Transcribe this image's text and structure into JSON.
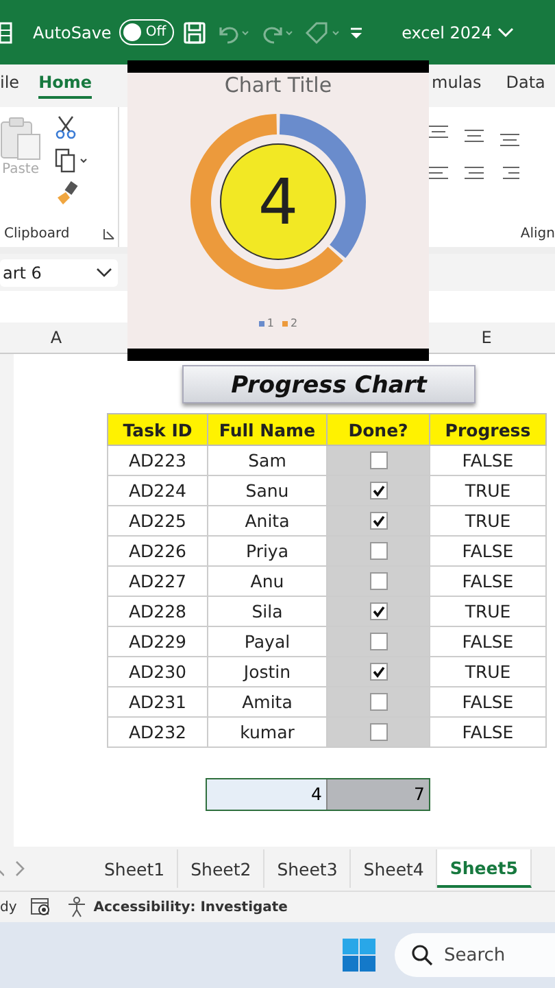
{
  "title_bar": {
    "autosave_label": "AutoSave",
    "autosave_toggle": {
      "label": "Off",
      "on": false
    },
    "workbook": "excel 2024"
  },
  "ribbon_tabs": [
    {
      "label": "ile",
      "selected": false
    },
    {
      "label": "Home",
      "selected": true
    },
    {
      "label": "mulas",
      "selected": false
    },
    {
      "label": "Data",
      "selected": false
    }
  ],
  "clipboard": {
    "paste_label": "Paste",
    "group_label": "Clipboard"
  },
  "alignment_group_label": "Align",
  "name_box": "art 6",
  "column_headers": [
    "A",
    "E"
  ],
  "chart": {
    "center_value": "4",
    "chart_data": {
      "type": "donut",
      "title": "Chart Title",
      "categories": [
        "1",
        "2"
      ],
      "values": [
        36.4,
        63.6
      ]
    },
    "legend": [
      {
        "color": "#6a8ccc"
      },
      {
        "color": "#ec9a3c"
      }
    ]
  },
  "progress_title": "Progress Chart",
  "table": {
    "columns": [
      "Task ID",
      "Full Name",
      "Done?",
      "Progress"
    ],
    "rows": [
      {
        "task_id": "AD223",
        "name": "Sam",
        "done": false,
        "progress": "FALSE"
      },
      {
        "task_id": "AD224",
        "name": "Sanu",
        "done": true,
        "progress": "TRUE"
      },
      {
        "task_id": "AD225",
        "name": "Anita",
        "done": true,
        "progress": "TRUE"
      },
      {
        "task_id": "AD226",
        "name": "Priya",
        "done": false,
        "progress": "FALSE"
      },
      {
        "task_id": "AD227",
        "name": "Anu",
        "done": false,
        "progress": "FALSE"
      },
      {
        "task_id": "AD228",
        "name": "Sila",
        "done": true,
        "progress": "TRUE"
      },
      {
        "task_id": "AD229",
        "name": "Payal",
        "done": false,
        "progress": "FALSE"
      },
      {
        "task_id": "AD230",
        "name": "Jostin",
        "done": true,
        "progress": "TRUE"
      },
      {
        "task_id": "AD231",
        "name": "Amita",
        "done": false,
        "progress": "FALSE"
      },
      {
        "task_id": "AD232",
        "name": "kumar",
        "done": false,
        "progress": "FALSE"
      }
    ]
  },
  "summary_cells": [
    "4",
    "7"
  ],
  "sheet_tabs": [
    {
      "label": "Sheet1",
      "selected": false
    },
    {
      "label": "Sheet2",
      "selected": false
    },
    {
      "label": "Sheet3",
      "selected": false
    },
    {
      "label": "Sheet4",
      "selected": false
    },
    {
      "label": "Sheet5",
      "selected": true
    }
  ],
  "status_bar": {
    "mode": "dy",
    "accessibility": "Accessibility: Investigate"
  },
  "taskbar": {
    "search_placeholder": "Search"
  }
}
